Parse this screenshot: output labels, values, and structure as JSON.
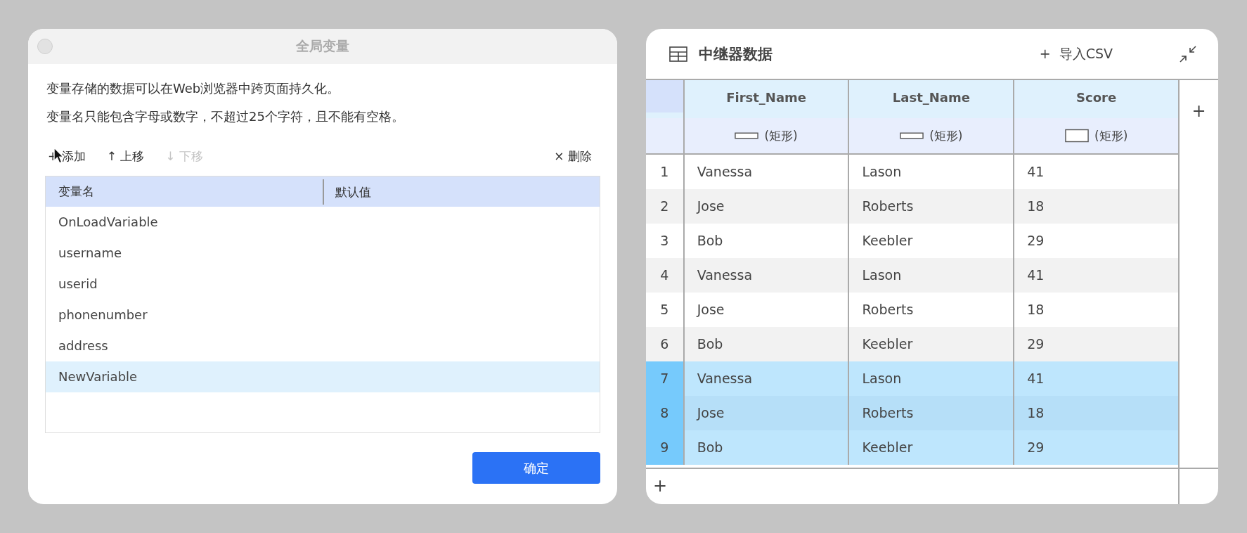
{
  "variables_dialog": {
    "title": "全局变量",
    "description": [
      "变量存储的数据可以在Web浏览器中跨页面持久化。",
      "变量名只能包含字母或数字，不超过25个字符，且不能有空格。"
    ],
    "toolbar": [
      {
        "icon": "+",
        "label": "添加",
        "disabled": false
      },
      {
        "icon": "↑",
        "label": "上移",
        "disabled": false
      },
      {
        "icon": "↓",
        "label": "下移",
        "disabled": true
      },
      {
        "icon": "×",
        "label": "删除",
        "disabled": false
      }
    ],
    "table": {
      "columns": [
        "变量名",
        "默认值"
      ],
      "rows": [
        {
          "name": "OnLoadVariable",
          "selected": false
        },
        {
          "name": "username",
          "selected": false
        },
        {
          "name": "userid",
          "selected": false
        },
        {
          "name": "phonenumber",
          "selected": false
        },
        {
          "name": "address",
          "selected": false
        },
        {
          "name": "NewVariable",
          "selected": true
        }
      ]
    },
    "ok_button": "确定"
  },
  "repeater_panel": {
    "title": "中继器数据",
    "import_button": {
      "icon": "+",
      "label": "导入CSV"
    },
    "columns": [
      {
        "name": "First_Name",
        "target": "(矩形)"
      },
      {
        "name": "Last_Name",
        "target": "(矩形)"
      },
      {
        "name": "Score",
        "target": "(矩形)"
      }
    ],
    "add_column": "+",
    "add_row": "+",
    "rows": [
      {
        "index": "1",
        "cells": [
          "Vanessa",
          "Lason",
          "41"
        ],
        "selected": false
      },
      {
        "index": "2",
        "cells": [
          "Jose",
          "Roberts",
          "18"
        ],
        "selected": false
      },
      {
        "index": "3",
        "cells": [
          "Bob",
          "Keebler",
          "29"
        ],
        "selected": false
      },
      {
        "index": "4",
        "cells": [
          "Vanessa",
          "Lason",
          "41"
        ],
        "selected": false
      },
      {
        "index": "5",
        "cells": [
          "Jose",
          "Roberts",
          "18"
        ],
        "selected": false
      },
      {
        "index": "6",
        "cells": [
          "Bob",
          "Keebler",
          "29"
        ],
        "selected": false
      },
      {
        "index": "7",
        "cells": [
          "Vanessa",
          "Lason",
          "41"
        ],
        "selected": true
      },
      {
        "index": "8",
        "cells": [
          "Jose",
          "Roberts",
          "18"
        ],
        "selected": true
      },
      {
        "index": "9",
        "cells": [
          "Bob",
          "Keebler",
          "29"
        ],
        "selected": true
      }
    ]
  }
}
